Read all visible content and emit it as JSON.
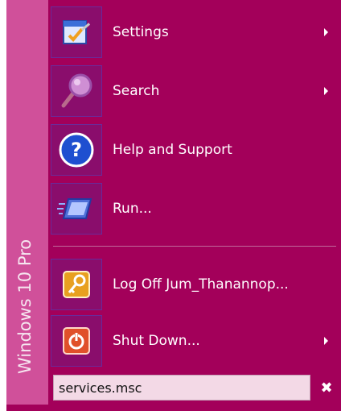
{
  "sidebar": {
    "edition_text": "Windows 10 Pro"
  },
  "menu": {
    "items": [
      {
        "label": "Settings",
        "icon": "settings-icon",
        "has_submenu": true
      },
      {
        "label": "Search",
        "icon": "search-icon",
        "has_submenu": true
      },
      {
        "label": "Help and Support",
        "icon": "help-icon",
        "has_submenu": false
      },
      {
        "label": "Run...",
        "icon": "run-icon",
        "has_submenu": false
      },
      {
        "label": "Log Off Jum_Thanannop...",
        "icon": "log-off-key-icon",
        "has_submenu": false
      },
      {
        "label": "Shut Down...",
        "icon": "power-icon",
        "has_submenu": true
      }
    ]
  },
  "search": {
    "value": "services.msc",
    "clear_glyph": "✖"
  },
  "colors": {
    "menu_background": "#a3005a",
    "sidebar_background": "#d0509a",
    "icon_box": "#8a0d6c",
    "search_field": "#f3d9e6"
  }
}
